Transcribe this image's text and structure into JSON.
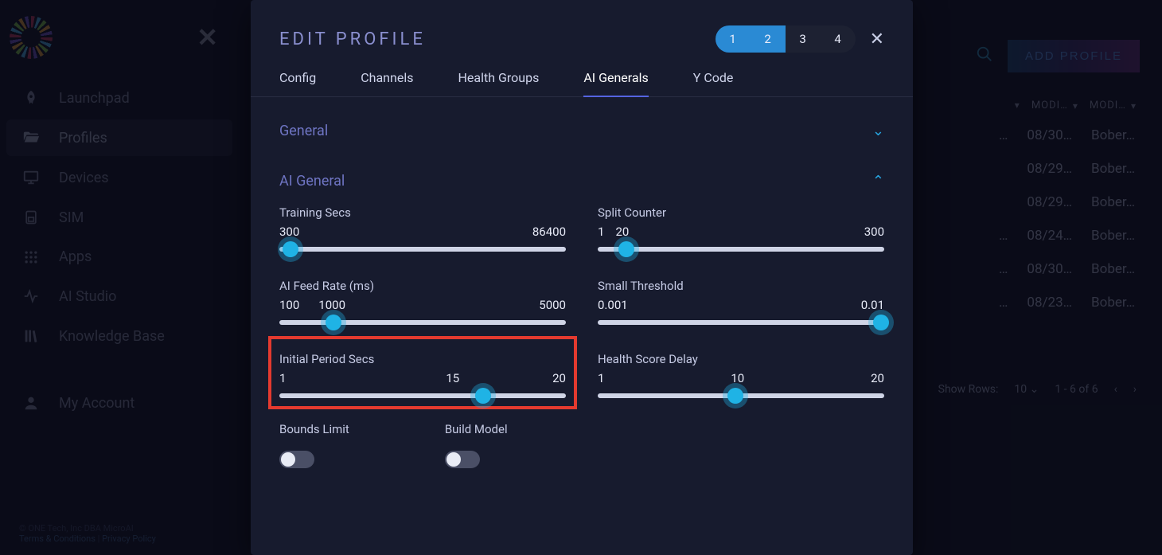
{
  "sidebar": {
    "items": [
      {
        "label": "Launchpad",
        "icon": "rocket-icon"
      },
      {
        "label": "Profiles",
        "icon": "folder-open-icon",
        "active": true
      },
      {
        "label": "Devices",
        "icon": "monitor-icon"
      },
      {
        "label": "SIM",
        "icon": "sim-icon"
      },
      {
        "label": "Apps",
        "icon": "grid-icon"
      },
      {
        "label": "AI Studio",
        "icon": "spark-icon"
      },
      {
        "label": "Knowledge Base",
        "icon": "library-icon"
      }
    ],
    "account_label": "My Account",
    "footer_copyright": "© ONE Tech, Inc DBA MicroAI",
    "footer_terms": "Terms & Conditions",
    "footer_privacy": "Privacy Policy"
  },
  "header": {
    "add_profile": "ADD PROFILE"
  },
  "table": {
    "headers": [
      "MODI…",
      "MODI…"
    ],
    "rows": [
      {
        "col0_prefix": "…",
        "date": "08/30…",
        "user": "Bober…"
      },
      {
        "col0_prefix": "",
        "date": "08/29…",
        "user": "Bober…"
      },
      {
        "col0_prefix": "",
        "date": "08/29…",
        "user": "Bober…"
      },
      {
        "col0_prefix": "…",
        "date": "08/24…",
        "user": "Bober…"
      },
      {
        "col0_prefix": "…",
        "date": "08/30…",
        "user": "Bober…"
      },
      {
        "col0_prefix": "…",
        "date": "08/23…",
        "user": "Bober…"
      }
    ],
    "show_rows_label": "Show Rows:",
    "show_rows_value": "10",
    "range": "1 - 6 of 6"
  },
  "modal": {
    "title": "EDIT PROFILE",
    "steps": [
      "1",
      "2",
      "3",
      "4"
    ],
    "active_steps": [
      0,
      1
    ],
    "tabs": [
      "Config",
      "Channels",
      "Health Groups",
      "AI Generals",
      "Y Code"
    ],
    "active_tab": 3,
    "sections": {
      "general": {
        "title": "General",
        "expanded": false
      },
      "ai_general": {
        "title": "AI General",
        "expanded": true
      }
    },
    "sliders": {
      "training_secs": {
        "label": "Training Secs",
        "min": "300",
        "max": "86400",
        "thumb_pct": 4
      },
      "split_counter": {
        "label": "Split Counter",
        "min": "1",
        "val": "20",
        "max": "300",
        "thumb_pct": 10
      },
      "ai_feed_rate": {
        "label": "AI Feed Rate (ms)",
        "min": "100",
        "val": "1000",
        "max": "5000",
        "thumb_pct": 19
      },
      "small_threshold": {
        "label": "Small Threshold",
        "min": "0.001",
        "max": "0.01",
        "thumb_pct": 99
      },
      "initial_period_secs": {
        "label": "Initial Period Secs",
        "min": "1",
        "val": "15",
        "max": "20",
        "thumb_pct": 71,
        "highlighted": true
      },
      "health_score_delay": {
        "label": "Health Score Delay",
        "min": "1",
        "val": "10",
        "max": "20",
        "thumb_pct": 48
      }
    },
    "toggles": {
      "bounds_limit": {
        "label": "Bounds Limit",
        "on": false
      },
      "build_model": {
        "label": "Build Model",
        "on": false
      }
    }
  }
}
